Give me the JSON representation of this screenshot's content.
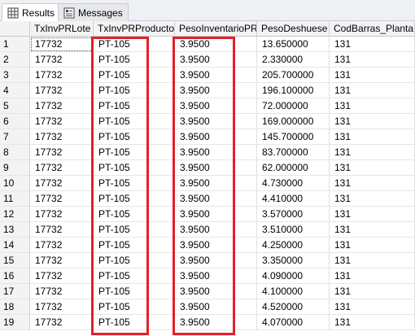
{
  "tabs": [
    {
      "label": "Results",
      "icon": "grid-icon",
      "active": true
    },
    {
      "label": "Messages",
      "icon": "messages-icon",
      "active": false
    }
  ],
  "columns": [
    "",
    "TxInvPRLote",
    "TxInvPRProducto",
    "PesoInventarioPR",
    "PesoDeshuese",
    "CodBarras_Planta"
  ],
  "rows": [
    [
      "1",
      "17732",
      "PT-105",
      "3.9500",
      "13.650000",
      "131"
    ],
    [
      "2",
      "17732",
      "PT-105",
      "3.9500",
      "2.330000",
      "131"
    ],
    [
      "3",
      "17732",
      "PT-105",
      "3.9500",
      "205.700000",
      "131"
    ],
    [
      "4",
      "17732",
      "PT-105",
      "3.9500",
      "196.100000",
      "131"
    ],
    [
      "5",
      "17732",
      "PT-105",
      "3.9500",
      "72.000000",
      "131"
    ],
    [
      "6",
      "17732",
      "PT-105",
      "3.9500",
      "169.000000",
      "131"
    ],
    [
      "7",
      "17732",
      "PT-105",
      "3.9500",
      "145.700000",
      "131"
    ],
    [
      "8",
      "17732",
      "PT-105",
      "3.9500",
      "83.700000",
      "131"
    ],
    [
      "9",
      "17732",
      "PT-105",
      "3.9500",
      "62.000000",
      "131"
    ],
    [
      "10",
      "17732",
      "PT-105",
      "3.9500",
      "4.730000",
      "131"
    ],
    [
      "11",
      "17732",
      "PT-105",
      "3.9500",
      "4.410000",
      "131"
    ],
    [
      "12",
      "17732",
      "PT-105",
      "3.9500",
      "3.570000",
      "131"
    ],
    [
      "13",
      "17732",
      "PT-105",
      "3.9500",
      "3.510000",
      "131"
    ],
    [
      "14",
      "17732",
      "PT-105",
      "3.9500",
      "4.250000",
      "131"
    ],
    [
      "15",
      "17732",
      "PT-105",
      "3.9500",
      "3.350000",
      "131"
    ],
    [
      "16",
      "17732",
      "PT-105",
      "3.9500",
      "4.090000",
      "131"
    ],
    [
      "17",
      "17732",
      "PT-105",
      "3.9500",
      "4.100000",
      "131"
    ],
    [
      "18",
      "17732",
      "PT-105",
      "3.9500",
      "4.520000",
      "131"
    ],
    [
      "19",
      "17732",
      "PT-105",
      "3.9500",
      "4.070000",
      "131"
    ]
  ],
  "highlight_color": "#e3202b"
}
